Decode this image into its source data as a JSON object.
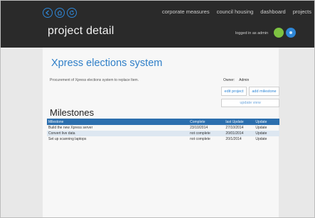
{
  "topnav": {
    "items": [
      "corporate measures",
      "council housing",
      "dashboard",
      "projects"
    ]
  },
  "header": {
    "page_title": "project detail",
    "logged_in_text": "logged in as admin"
  },
  "project": {
    "title": "Xpress elections system",
    "description": "Procurement of Xpress elections system to replace ltem.",
    "owner_label": "Owner:",
    "owner_value": "Admin",
    "edit_label": "edit project",
    "add_milestone_label": "add milestone",
    "update_label": "update view"
  },
  "milestones": {
    "title": "Milestones",
    "columns": [
      "Milestone",
      "Complete",
      "last Update",
      "Update"
    ],
    "rows": [
      {
        "name": "Build the new Xpress server",
        "complete": "23/10/2014",
        "last_update": "27/10/2014",
        "action": "Update"
      },
      {
        "name": "Convert live data",
        "complete": "not complete",
        "last_update": "20/01/2014",
        "action": "Update"
      },
      {
        "name": "Set up scanning laptops",
        "complete": "not complete",
        "last_update": "20/1/2014",
        "action": "Update"
      }
    ]
  },
  "colors": {
    "header_bg": "#2a2a2a",
    "accent": "#2e86d6",
    "table_header": "#2c6fae",
    "avatar_green": "#7dc241"
  }
}
